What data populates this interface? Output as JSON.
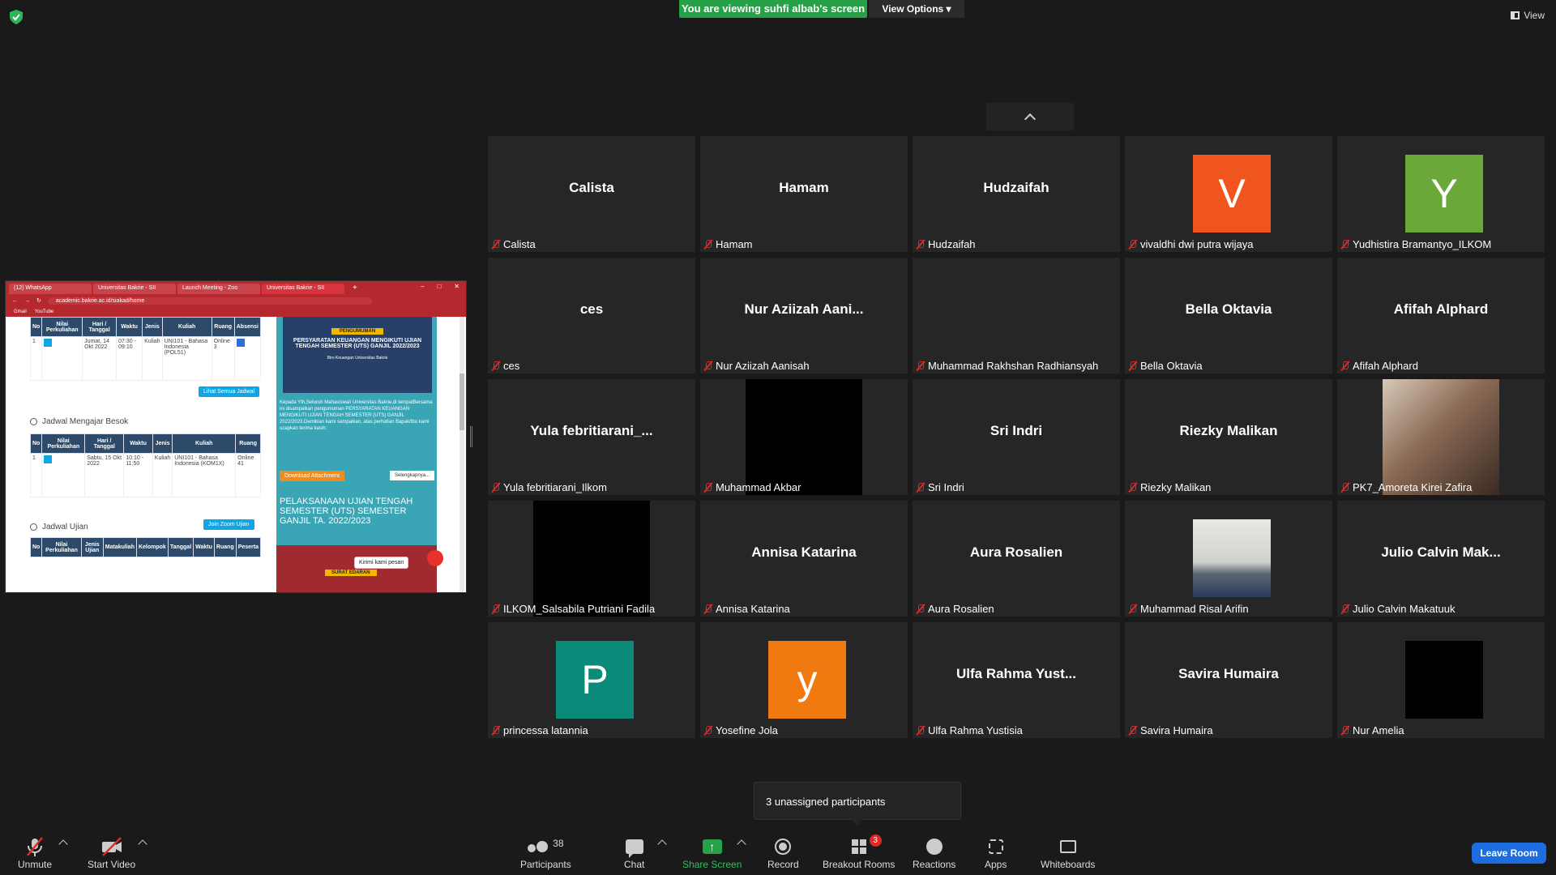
{
  "top": {
    "banner": "You are viewing suhfi albab's screen",
    "view_options": "View Options",
    "view_label": "View"
  },
  "shared_screen": {
    "tabs": [
      "(12) WhatsApp",
      "Universitas Bakrie - SII",
      "Launch Meeting - Zoo",
      "Universitas Bakrie - SII"
    ],
    "url": "academic.bakrie.ac.id/siakad/home",
    "bookmarks": [
      "Gmail",
      "YouTube"
    ],
    "table1": {
      "headers": [
        "No",
        "Nilai Perkuliahan",
        "Hari / Tanggal",
        "Waktu",
        "Jenis",
        "Kuliah",
        "Ruang",
        "Absensi"
      ],
      "row": [
        "1",
        "",
        "Jumat, 14 Okt 2022",
        "07:30 - 09:10",
        "Kuliah",
        "UNI101 - Bahasa Indonesia (POL51)",
        "Online 3",
        ""
      ]
    },
    "lihat_semua": "Lihat Semua Jadwal",
    "section2": "Jadwal Mengajar Besok",
    "table2": {
      "headers": [
        "No",
        "Nilai Perkuliahan",
        "Hari / Tanggal",
        "Waktu",
        "Jenis",
        "Kuliah",
        "Ruang"
      ],
      "row": [
        "1",
        "",
        "Sabtu, 15 Okt 2022",
        "10:10 - 11:50",
        "Kuliah",
        "UNI101 - Bahasa Indonesia (KOM1X)",
        "Online 41"
      ]
    },
    "section3": "Jadwal Ujian",
    "join_zoom": "Join Zoom Ujian",
    "table3": {
      "headers": [
        "No",
        "Nilai Perkuliahan",
        "Jenis Ujian",
        "Matakuliah",
        "Kelompok",
        "Tanggal",
        "Waktu",
        "Ruang",
        "Peserta"
      ]
    },
    "poster_badge": "PENGUMUMAN",
    "poster_title": "PERSYARATAN KEUANGAN MENGIKUTI UJIAN TENGAH SEMESTER (UTS) GANJIL 2022/2023",
    "poster_sub": "Biro Keuangan Universitas Bakrie",
    "announcement_text": "Kepada Yth,Seluruh Mahasiswa/i Universitas Bakrie,di tempatBersama ini disampaikan pengumuman PERSYARATAN KEUANGAN MENGIKUTI UJIAN TENGAH SEMESTER (UTS) GANJIL 2022/2023.Demikian kami sampaikan, atas perhatian Bapak/Ibu kami ucapkan terima kasih.",
    "download_btn": "Download Attachment",
    "selengkapnya": "Selengkapnya...",
    "pelaksanaan": "PELAKSANAAN UJIAN TENGAH SEMESTER (UTS) SEMESTER GANJIL TA. 2022/2023",
    "surat_edaran": "SURAT EDARAN",
    "chat_bubble": "Kirimi kami pesan"
  },
  "tiles": [
    {
      "big": "Calista",
      "name": "Calista",
      "type": "text"
    },
    {
      "big": "Hamam",
      "name": "Hamam",
      "type": "text"
    },
    {
      "big": "Hudzaifah",
      "name": "Hudzaifah",
      "type": "text"
    },
    {
      "big": "V",
      "name": "vivaldhi dwi putra wijaya",
      "type": "avatar",
      "color": "#f0541f"
    },
    {
      "big": "Y",
      "name": "Yudhistira Bramantyo_ILKOM",
      "type": "avatar",
      "color": "#6aa83a"
    },
    {
      "big": "ces",
      "name": "ces",
      "type": "text"
    },
    {
      "big": "Nur Aziizah Aani...",
      "name": "Nur Aziizah Aanisah",
      "type": "text"
    },
    {
      "big": "",
      "name": "Muhammad Rakhshan Radhiansyah",
      "type": "empty"
    },
    {
      "big": "Bella Oktavia",
      "name": "Bella Oktavia",
      "type": "text"
    },
    {
      "big": "Afifah Alphard",
      "name": "Afifah Alphard",
      "type": "text"
    },
    {
      "big": "Yula  febritiarani_...",
      "name": "Yula febritiarani_Ilkom",
      "type": "text"
    },
    {
      "big": "",
      "name": "Muhammad Akbar",
      "type": "black"
    },
    {
      "big": "Sri Indri",
      "name": "Sri Indri",
      "type": "text"
    },
    {
      "big": "Riezky Malikan",
      "name": "Riezky Malikan",
      "type": "text"
    },
    {
      "big": "",
      "name": "PK7_Amoreta Kirei Zafira",
      "type": "photo-face"
    },
    {
      "big": "",
      "name": "ILKOM_Salsabila Putriani Fadila",
      "type": "black"
    },
    {
      "big": "Annisa Katarina",
      "name": "Annisa Katarina",
      "type": "text"
    },
    {
      "big": "Aura Rosalien",
      "name": "Aura Rosalien",
      "type": "text"
    },
    {
      "big": "",
      "name": "Muhammad Risal Arifin",
      "type": "photo-car"
    },
    {
      "big": "Julio Calvin Mak...",
      "name": "Julio Calvin Makatuuk",
      "type": "text"
    },
    {
      "big": "P",
      "name": "princessa latannia",
      "type": "avatar",
      "color": "#0b8a7a"
    },
    {
      "big": "y",
      "name": "Yosefine Jola",
      "type": "avatar",
      "color": "#f07a0f"
    },
    {
      "big": "Ulfa Rahma Yust...",
      "name": "Ulfa Rahma Yustisia",
      "type": "text"
    },
    {
      "big": "Savira Humaira",
      "name": "Savira Humaira",
      "type": "text"
    },
    {
      "big": "",
      "name": "Nur Amelia",
      "type": "black-small"
    }
  ],
  "unassigned": "3 unassigned participants",
  "toolbar": {
    "unmute": "Unmute",
    "start_video": "Start Video",
    "participants": "Participants",
    "participants_count": "38",
    "chat": "Chat",
    "share_screen": "Share Screen",
    "record": "Record",
    "breakout_rooms": "Breakout Rooms",
    "breakout_badge": "3",
    "reactions": "Reactions",
    "apps": "Apps",
    "whiteboards": "Whiteboards",
    "leave": "Leave Room"
  }
}
